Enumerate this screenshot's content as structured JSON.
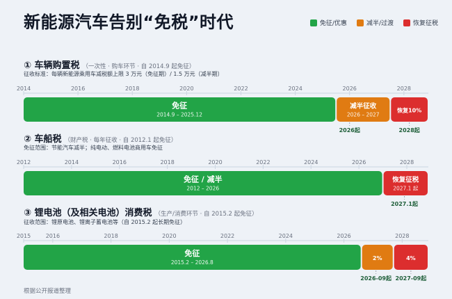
{
  "title": "新能源汽车告别“免税”时代",
  "legend": [
    {
      "label": "免征/优惠",
      "color": "#22a447"
    },
    {
      "label": "减半/过渡",
      "color": "#e07b12"
    },
    {
      "label": "恢复征税",
      "color": "#dc2e2e"
    }
  ],
  "footer": "根据公开报道整理",
  "chart_data": [
    {
      "type": "timeline",
      "title": "① 车辆购置税",
      "subtitle": "（一次性 · 购车环节 · 自 2014.9 起免征）",
      "note": "征收标准：每辆新能源乘用车减税额上限 3 万元（免征期）/ 1.5 万元（减半期）",
      "xlim": [
        2014,
        2028.9
      ],
      "ticks": [
        2014,
        2016,
        2018,
        2020,
        2022,
        2024,
        2026,
        2028
      ],
      "segments": [
        {
          "start": 2014.0,
          "end": 2025.5,
          "label": "免征",
          "sublabel": "2014.9 – 2025.12",
          "category": "免征/优惠",
          "color": "#22a447"
        },
        {
          "start": 2025.5,
          "end": 2027.5,
          "label": "减半征收",
          "sublabel": "2026 – 2027",
          "category": "减半/过渡",
          "color": "#e07b12"
        },
        {
          "start": 2027.5,
          "end": 2028.9,
          "label": "恢复10%",
          "sublabel": "",
          "category": "恢复征税",
          "color": "#dc2e2e"
        }
      ],
      "markers": [
        {
          "x": 2026.0,
          "label": "2026起"
        },
        {
          "x": 2028.2,
          "label": "2028起"
        }
      ]
    },
    {
      "type": "timeline",
      "title": "② 车船税",
      "subtitle": "（财产税 · 每年征收 · 自 2012.1 起免征）",
      "note": "免征范围：节能汽车减半；纯电动、燃料电池商用车免征",
      "xlim": [
        2012,
        2028.9
      ],
      "ticks": [
        2012,
        2014,
        2016,
        2018,
        2020,
        2022,
        2024,
        2026,
        2028
      ],
      "segments": [
        {
          "start": 2012.0,
          "end": 2027.0,
          "label": "免征 / 减半",
          "sublabel": "2012 – 2026",
          "category": "免征/优惠",
          "color": "#22a447"
        },
        {
          "start": 2027.0,
          "end": 2028.9,
          "label": "恢复征税",
          "sublabel": "2027.1 起",
          "category": "恢复征税",
          "color": "#dc2e2e"
        }
      ],
      "markers": [
        {
          "x": 2027.9,
          "label": "2027.1起"
        }
      ]
    },
    {
      "type": "timeline",
      "title": "③ 锂电池（及相关电池）消费税",
      "subtitle": "（生产/消费环节 · 自 2015.2 起免征）",
      "note": "征收范围：锂原电池、锂离子蓄电池等（自 2015.2 起长期免征）",
      "xlim": [
        2015,
        2028.9
      ],
      "ticks": [
        2015,
        2016,
        2018,
        2020,
        2022,
        2024,
        2026,
        2028
      ],
      "segments": [
        {
          "start": 2015.0,
          "end": 2026.6,
          "label": "免征",
          "sublabel": "2015.2 – 2026.8",
          "category": "免征/优惠",
          "color": "#22a447"
        },
        {
          "start": 2026.6,
          "end": 2027.7,
          "label": "2%",
          "sublabel": "",
          "category": "减半/过渡",
          "color": "#e07b12"
        },
        {
          "start": 2027.7,
          "end": 2028.9,
          "label": "4%",
          "sublabel": "",
          "category": "恢复征税",
          "color": "#dc2e2e"
        }
      ],
      "markers": [
        {
          "x": 2027.1,
          "label": "2026-09起"
        },
        {
          "x": 2028.3,
          "label": "2027-09起"
        }
      ]
    }
  ]
}
